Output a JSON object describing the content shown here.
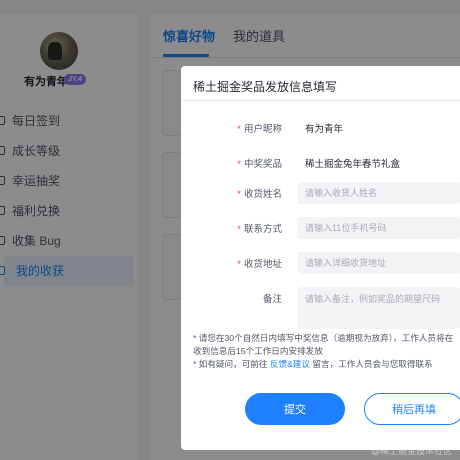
{
  "profile": {
    "username": "有为青年",
    "badge": "JY.4"
  },
  "sidebar": {
    "items": [
      {
        "label": "每日签到",
        "icon": "calendar-icon",
        "active": false
      },
      {
        "label": "成长等级",
        "icon": "level-icon",
        "active": false
      },
      {
        "label": "幸运抽奖",
        "icon": "lottery-icon",
        "active": false
      },
      {
        "label": "福利兑换",
        "icon": "gift-icon",
        "active": false
      },
      {
        "label": "收集 Bug",
        "icon": "bug-icon",
        "active": false
      },
      {
        "label": "我的收获",
        "icon": "harvest-icon",
        "active": true
      }
    ]
  },
  "main": {
    "tabs": [
      {
        "label": "惊喜好物",
        "active": true
      },
      {
        "label": "我的道具",
        "active": false
      }
    ]
  },
  "modal": {
    "title": "稀土掘金奖品发放信息填写",
    "fields": {
      "nickname": {
        "label": "用户昵称",
        "value": "有为青年",
        "required": true
      },
      "prize": {
        "label": "中奖奖品",
        "value": "稀土掘金兔年春节礼盒",
        "required": true
      },
      "name": {
        "label": "收货姓名",
        "placeholder": "请输入收货人姓名",
        "required": true
      },
      "phone": {
        "label": "联系方式",
        "placeholder": "请输入11位手机号码",
        "required": true
      },
      "address": {
        "label": "收货地址",
        "placeholder": "请输入详细收货地址",
        "required": true
      },
      "remark": {
        "label": "备注",
        "placeholder": "请输入备注，例如奖品的期望尺码",
        "required": false
      }
    },
    "notes": {
      "line1": "* 请您在30个自然日内填写中奖信息（逾期视为放弃），工作人员将在收到信息后15个工作日内安排发放",
      "line2_prefix": "* 如有疑问，可前往 ",
      "line2_link": "反馈&建议",
      "line2_suffix": " 留言，工作人员会与您取得联系"
    },
    "submit_label": "提交",
    "later_label": "稍后再填"
  },
  "watermark": "@稀土掘金技术社区",
  "colors": {
    "accent": "#1e80ff",
    "required": "#f53f3f",
    "badge": "#8a7df4"
  }
}
